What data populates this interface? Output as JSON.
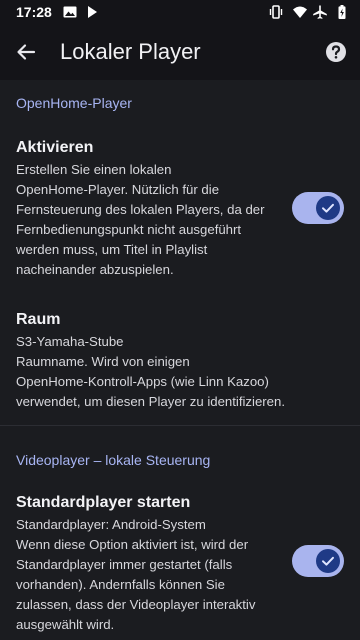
{
  "status_bar": {
    "time": "17:28",
    "left_icons": [
      "image-icon",
      "play-icon"
    ],
    "right_icons": [
      "vibrate-icon",
      "wifi-icon",
      "airplane-icon",
      "battery-icon"
    ]
  },
  "app_bar": {
    "title": "Lokaler Player",
    "back_icon": "arrow-back-icon",
    "help_icon": "help-icon"
  },
  "sections": [
    {
      "header": "OpenHome-Player",
      "prefs": [
        {
          "title": "Aktivieren",
          "lines": [
            "Erstellen Sie einen lokalen",
            "OpenHome-Player. Nützlich für die",
            "Fernsteuerung des lokalen Players, da der",
            "Fernbedienungspunkt nicht ausgeführt",
            "werden muss, um Titel in Playlist",
            "nacheinander abzuspielen."
          ],
          "switch_on": true
        },
        {
          "title": "Raum",
          "lines": [
            "S3-Yamaha-Stube",
            "Raumname. Wird von einigen",
            "OpenHome-Kontroll-Apps (wie Linn Kazoo)",
            "verwendet, um diesen Player zu identifizieren."
          ]
        }
      ]
    },
    {
      "header": "Videoplayer – lokale Steuerung",
      "prefs": [
        {
          "title": "Standardplayer starten",
          "lines": [
            "Standardplayer: Android-System",
            "Wenn diese Option aktiviert ist, wird der",
            "Standardplayer immer gestartet (falls",
            "vorhanden). Andernfalls können Sie",
            "zulassen, dass der Videoplayer interaktiv",
            "ausgewählt wird."
          ],
          "switch_on": true
        }
      ]
    }
  ],
  "colors": {
    "background": "#1b1c20",
    "app_bar": "#141418",
    "accent": "#a8b5f3",
    "switch_track": "#a9b4ee",
    "switch_thumb": "#1f3a86"
  }
}
